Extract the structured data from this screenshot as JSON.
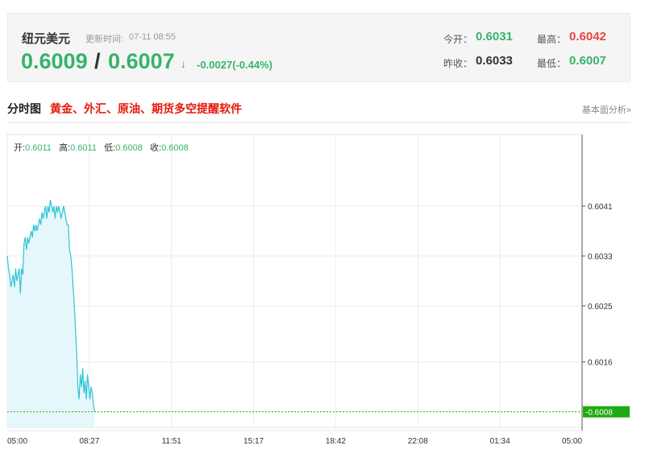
{
  "quote": {
    "name": "纽元美元",
    "update_label": "更新时间:",
    "update_time": "07-11 08:55",
    "bid": "0.6009",
    "slash": "/",
    "ask": "0.6007",
    "arrow": "↓",
    "change": "-0.0027(-0.44%)"
  },
  "stats": {
    "open_label": "今开：",
    "open": "0.6031",
    "high_label": "最高：",
    "high": "0.6042",
    "prev_label": "昨收：",
    "prev": "0.6033",
    "low_label": "最低：",
    "low": "0.6007"
  },
  "section": {
    "title": "分时图",
    "ad_link": "黄金、外汇、原油、期货多空提醒软件",
    "analysis_link": "基本面分析»"
  },
  "ohlc": {
    "open_label": "开:",
    "open": "0.6011",
    "high_label": "高:",
    "high": "0.6011",
    "low_label": "低:",
    "low": "0.6008",
    "close_label": "收:",
    "close": "0.6008"
  },
  "colors": {
    "up": "#36b36a",
    "down_red": "#e8463f",
    "line": "#2ec3d6",
    "fill": "#e6f7fb",
    "last_badge": "#1faa12"
  },
  "chart_data": {
    "type": "area",
    "x_ticks": [
      "05:00",
      "08:27",
      "11:51",
      "15:17",
      "18:42",
      "22:08",
      "01:34",
      "05:00"
    ],
    "y_ticks": [
      "0.6041",
      "0.6033",
      "0.6025",
      "0.6016"
    ],
    "ylim": [
      0.60055,
      0.60525
    ],
    "last_price": "0.6008",
    "grid": true,
    "x_minutes": [
      0,
      3,
      6,
      9,
      12,
      15,
      18,
      21,
      24,
      27,
      30,
      33,
      36,
      39,
      42,
      45,
      48,
      51,
      54,
      57,
      60,
      63,
      66,
      69,
      72,
      75,
      78,
      81,
      84,
      87,
      90,
      93,
      96,
      99,
      102,
      105,
      108,
      111,
      114,
      117,
      120,
      123,
      126,
      129,
      132,
      135,
      138,
      141,
      144,
      147,
      150,
      153,
      156,
      159,
      162,
      165,
      168,
      171,
      174,
      177,
      180,
      183,
      186,
      189,
      192,
      195,
      198,
      201,
      204,
      207,
      210,
      213,
      216,
      219
    ],
    "values": [
      0.6033,
      0.6031,
      0.603,
      0.6028,
      0.6029,
      0.603,
      0.6028,
      0.6031,
      0.6029,
      0.603,
      0.6031,
      0.6027,
      0.6031,
      0.603,
      0.6035,
      0.6036,
      0.6034,
      0.6036,
      0.6035,
      0.6036,
      0.6037,
      0.6036,
      0.6038,
      0.6037,
      0.6038,
      0.6037,
      0.6038,
      0.6039,
      0.6038,
      0.604,
      0.6039,
      0.604,
      0.6041,
      0.6039,
      0.6041,
      0.604,
      0.6042,
      0.6041,
      0.604,
      0.6041,
      0.6039,
      0.6041,
      0.604,
      0.6041,
      0.604,
      0.6039,
      0.604,
      0.6041,
      0.604,
      0.6039,
      0.6038,
      0.6038,
      0.6034,
      0.6033,
      0.6031,
      0.6028,
      0.6025,
      0.6021,
      0.6017,
      0.6012,
      0.601,
      0.6014,
      0.6012,
      0.6015,
      0.6011,
      0.6013,
      0.601,
      0.6014,
      0.6012,
      0.601,
      0.6012,
      0.6011,
      0.6009,
      0.6008
    ]
  }
}
